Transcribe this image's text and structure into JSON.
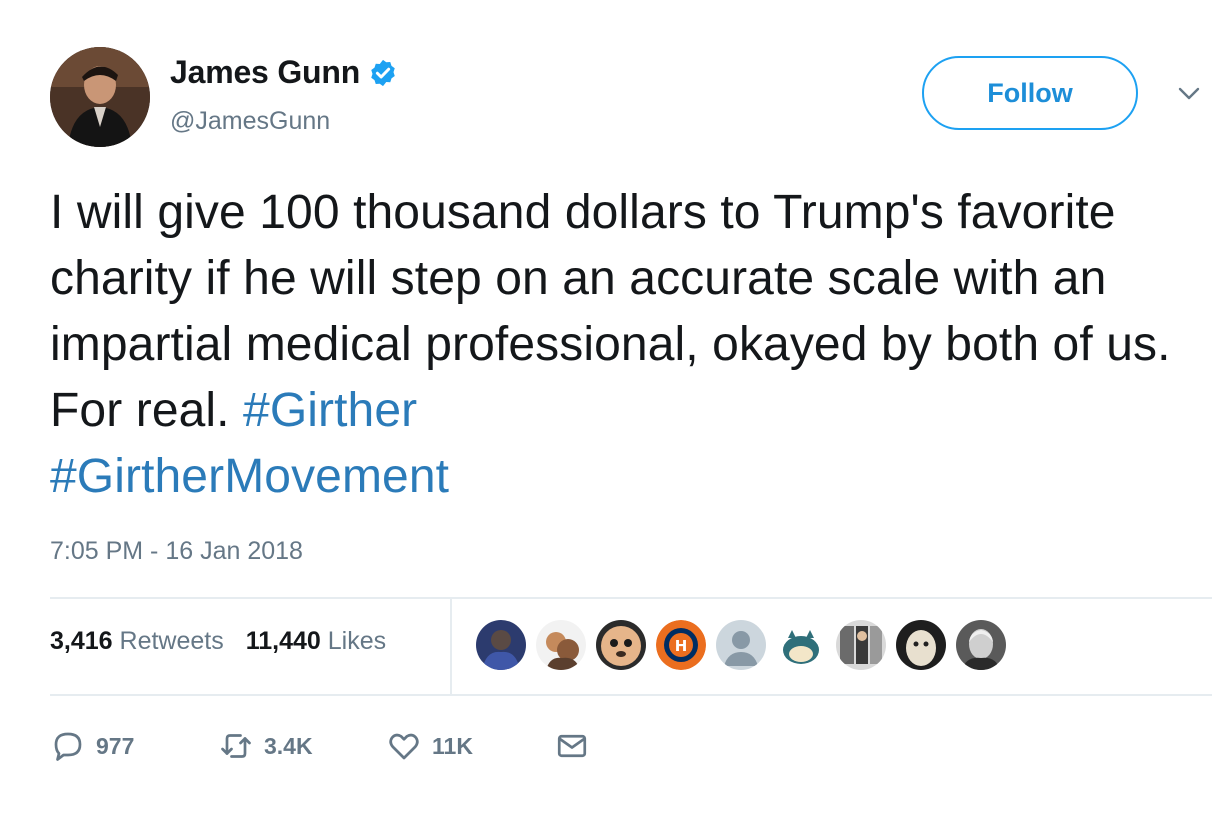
{
  "user": {
    "display_name": "James Gunn",
    "handle": "@JamesGunn",
    "verified_icon": "verified-badge-icon",
    "follow_label": "Follow"
  },
  "tweet": {
    "text_main": "I will give 100 thousand dollars to Trump's favorite charity if he will step on an accurate scale with an impartial medical professional, okayed by both of us. For real. ",
    "hashtag_1": "#Girther",
    "hashtag_2": "#GirtherMovement",
    "timestamp": "7:05 PM - 16 Jan 2018"
  },
  "stats": {
    "retweets_count": "3,416",
    "retweets_label": "Retweets",
    "likes_count": "11,440",
    "likes_label": "Likes"
  },
  "actions": {
    "reply_count": "977",
    "retweet_count": "3.4K",
    "like_count": "11K"
  },
  "colors": {
    "accent": "#1da1f2",
    "hashtag": "#2b7bb9",
    "muted": "#657786",
    "verified": "#1da1f2"
  }
}
